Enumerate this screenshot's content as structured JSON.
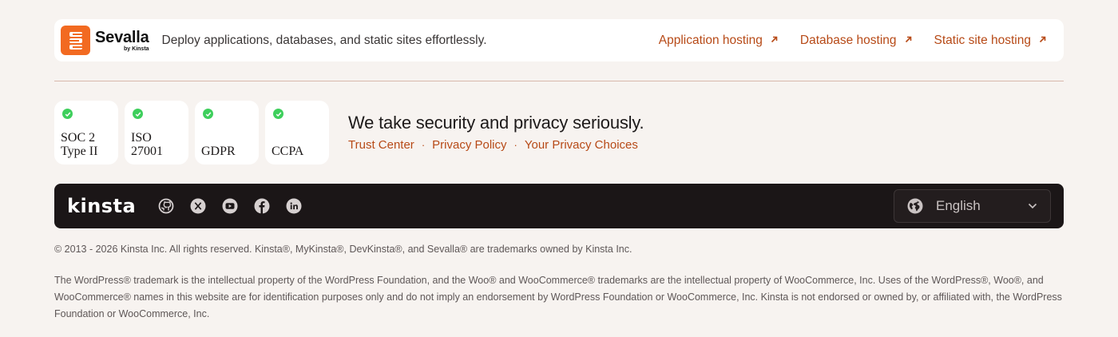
{
  "sevalla": {
    "name": "Sevalla",
    "by": "by Kinsta",
    "tagline": "Deploy applications, databases, and static sites effortlessly.",
    "links": [
      {
        "label": "Application hosting",
        "icon": "arrow-up-right-icon"
      },
      {
        "label": "Database hosting",
        "icon": "arrow-up-right-icon"
      },
      {
        "label": "Static site hosting",
        "icon": "arrow-up-right-icon"
      }
    ]
  },
  "badges": [
    {
      "label": "SOC 2\nType II"
    },
    {
      "label": "ISO\n27001"
    },
    {
      "label": "GDPR"
    },
    {
      "label": "CCPA"
    }
  ],
  "security": {
    "title": "We take security and privacy seriously.",
    "links": [
      "Trust Center",
      "Privacy Policy",
      "Your Privacy Choices"
    ],
    "separator": "·"
  },
  "footer_bar": {
    "logo": "kinsta",
    "socials": [
      "github-icon",
      "x-icon",
      "youtube-icon",
      "facebook-icon",
      "linkedin-icon"
    ],
    "language": "English"
  },
  "legal": {
    "copyright": "© 2013 - 2026 Kinsta Inc. All rights reserved. Kinsta®, MyKinsta®, DevKinsta®, and Sevalla® are trademarks owned by Kinsta Inc.",
    "disclaimer": "The WordPress® trademark is the intellectual property of the WordPress Foundation, and the Woo® and WooCommerce® trademarks are the intellectual property of WooCommerce, Inc. Uses of the WordPress®, Woo®, and WooCommerce® names in this website are for identification purposes only and do not imply an endorsement by WordPress Foundation or WooCommerce, Inc. Kinsta is not endorsed or owned by, or affiliated with, the WordPress Foundation or WooCommerce, Inc."
  },
  "colors": {
    "accent": "#b74a17",
    "sevalla_orange": "#f26a21",
    "check_green": "#3ecf5c",
    "dark_bar": "#1b1617",
    "background": "#f7f3f0"
  }
}
